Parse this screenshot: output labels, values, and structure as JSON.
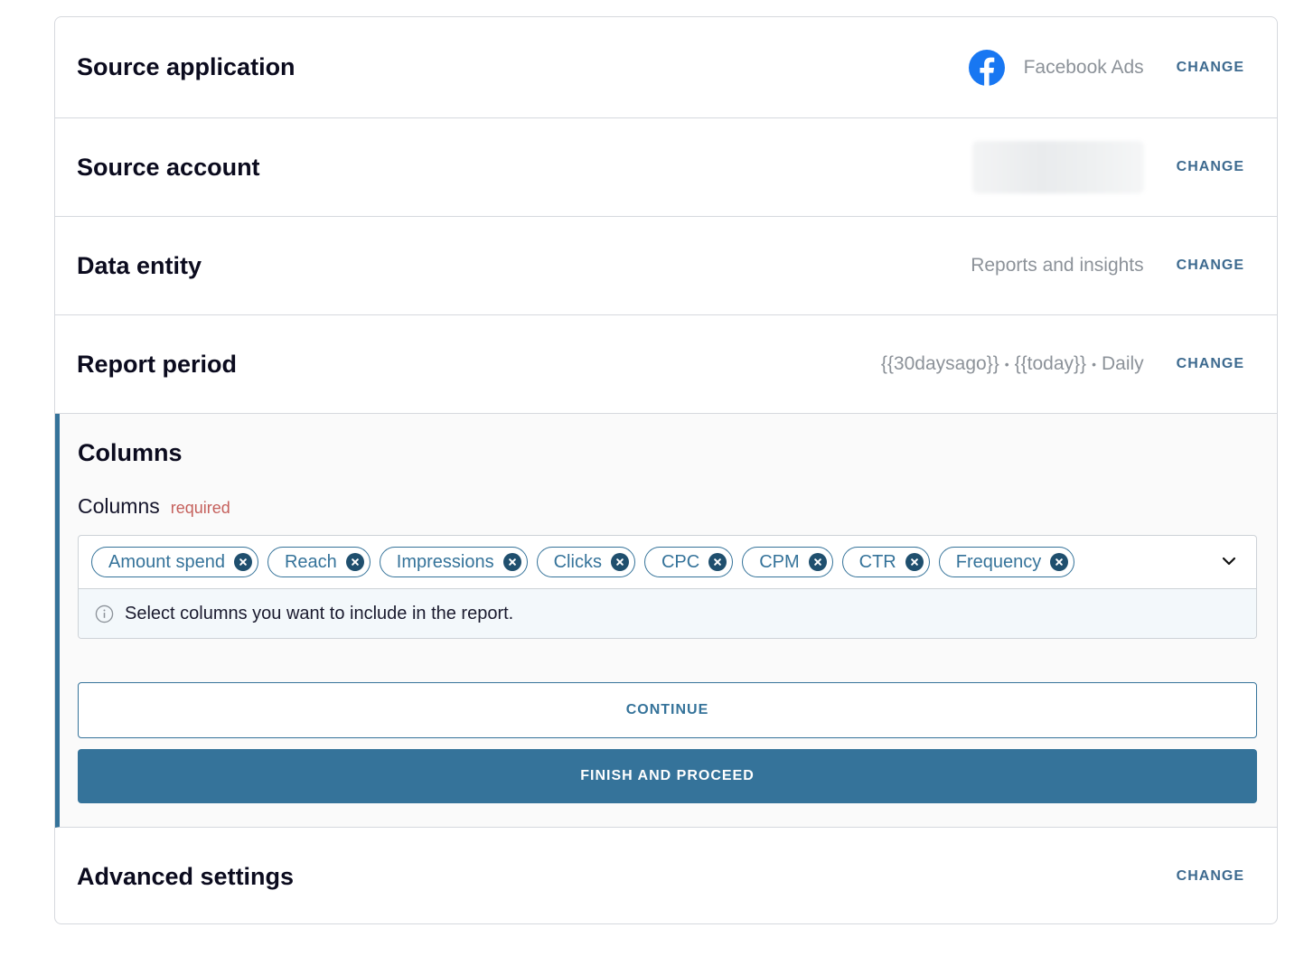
{
  "source_application": {
    "title": "Source application",
    "value": "Facebook Ads",
    "icon": "facebook-icon",
    "change_label": "CHANGE"
  },
  "source_account": {
    "title": "Source account",
    "change_label": "CHANGE"
  },
  "data_entity": {
    "title": "Data entity",
    "value": "Reports and insights",
    "change_label": "CHANGE"
  },
  "report_period": {
    "title": "Report period",
    "start": "{{30daysago}}",
    "end": "{{today}}",
    "granularity": "Daily",
    "separator": "•",
    "change_label": "CHANGE"
  },
  "columns": {
    "title": "Columns",
    "field_label": "Columns",
    "required_label": "required",
    "chips": [
      "Amount spend",
      "Reach",
      "Impressions",
      "Clicks",
      "CPC",
      "CPM",
      "CTR",
      "Frequency"
    ],
    "hint": "Select columns you want to include in the report.",
    "continue_label": "CONTINUE",
    "finish_label": "FINISH AND PROCEED"
  },
  "advanced_settings": {
    "title": "Advanced settings",
    "change_label": "CHANGE"
  },
  "colors": {
    "accent": "#35739a",
    "facebook": "#1877f2",
    "required": "#c5605c"
  }
}
